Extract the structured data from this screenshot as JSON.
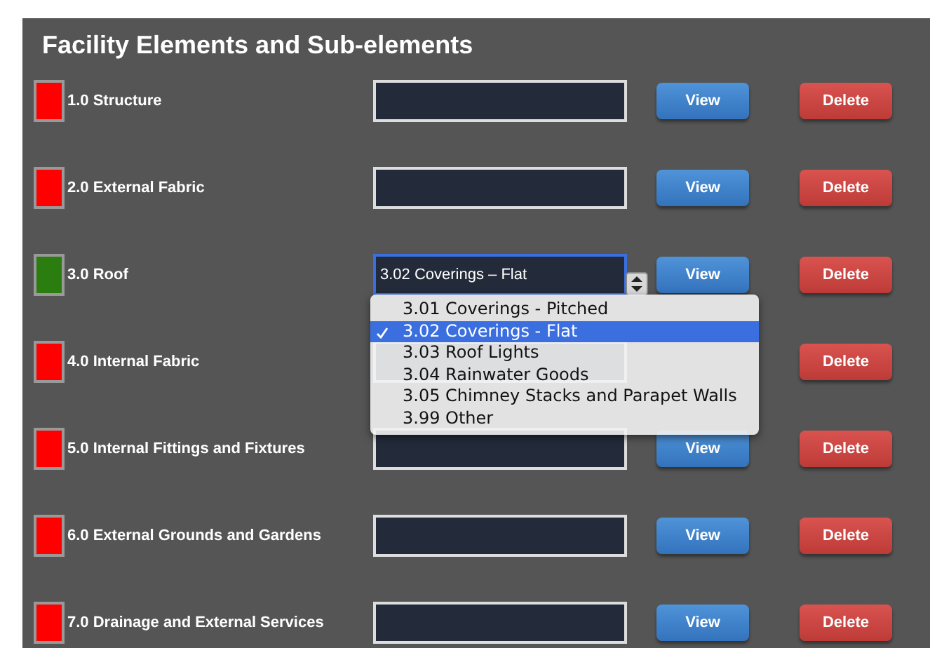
{
  "title": "Facility Elements and Sub-elements",
  "elements": [
    {
      "name": "1.0 Structure",
      "color": "#ff0000",
      "view": "View",
      "delete": "Delete"
    },
    {
      "name": "2.0 External Fabric",
      "color": "#ff0000",
      "view": "View",
      "delete": "Delete"
    },
    {
      "name": "3.0 Roof",
      "color": "#2a7d0e",
      "value": "3.02 Coverings – Flat",
      "view": "View",
      "delete": "Delete",
      "dropdown": {
        "options": [
          {
            "label": "3.01 Coverings - Pitched",
            "selected": false
          },
          {
            "label": "3.02 Coverings - Flat",
            "selected": true
          },
          {
            "label": "3.03 Roof Lights",
            "selected": false
          },
          {
            "label": "3.04 Rainwater Goods",
            "selected": false
          },
          {
            "label": "3.05 Chimney Stacks and Parapet Walls",
            "selected": false
          },
          {
            "label": "3.99 Other",
            "selected": false
          }
        ]
      }
    },
    {
      "name": "4.0 Internal Fabric",
      "color": "#ff0000",
      "delete": "Delete"
    },
    {
      "name": "5.0 Internal Fittings and Fixtures",
      "color": "#ff0000",
      "view": "View",
      "delete": "Delete"
    },
    {
      "name": "6.0 External Grounds and Gardens",
      "color": "#ff0000",
      "view": "View",
      "delete": "Delete"
    },
    {
      "name": "7.0 Drainage and External Services",
      "color": "#ff0000",
      "view": "View",
      "delete": "Delete"
    }
  ]
}
